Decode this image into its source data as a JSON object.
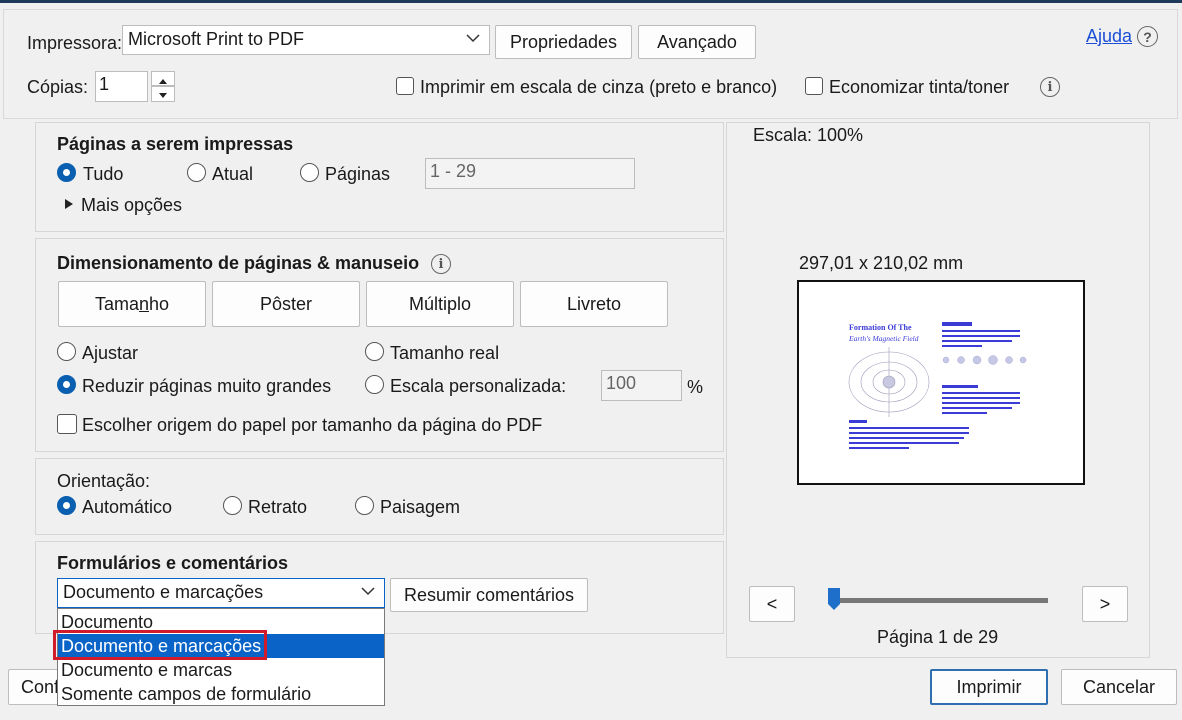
{
  "printer": {
    "label": "Impressora:",
    "selected": "Microsoft Print to PDF",
    "properties_button": "Propriedades",
    "advanced_button": "Avançado",
    "help_link": "Ajuda"
  },
  "copies": {
    "label": "Cópias:",
    "value": "1",
    "grayscale_label": "Imprimir em escala de cinza (preto e branco)",
    "save_ink_label": "Economizar tinta/toner"
  },
  "pages_to_print": {
    "title": "Páginas a serem impressas",
    "options": [
      "Tudo",
      "Atual",
      "Páginas"
    ],
    "selected": "Tudo",
    "range_value": "1 - 29",
    "more_options": "Mais opções"
  },
  "sizing": {
    "title": "Dimensionamento de páginas & manuseio",
    "tab_tamanho_pre": "Tama",
    "tab_tamanho_u": "n",
    "tab_tamanho_post": "ho",
    "tabs": [
      "Tamanho",
      "Pôster",
      "Múltiplo",
      "Livreto"
    ],
    "fit_label": "Ajustar",
    "actual_size_label": "Tamanho real",
    "shrink_label": "Reduzir páginas muito grandes",
    "custom_scale_label": "Escala personalizada:",
    "custom_scale_value": "100",
    "percent": "%",
    "paper_source_label": "Escolher origem do papel por tamanho da página do PDF"
  },
  "orientation": {
    "title": "Orientação:",
    "auto": "Automático",
    "portrait": "Retrato",
    "landscape": "Paisagem"
  },
  "forms": {
    "title": "Formulários e comentários",
    "selected": "Documento e marcações",
    "summarize_button": "Resumir comentários",
    "options": [
      "Documento",
      "Documento e marcações",
      "Documento e marcas",
      "Somente campos de formulário"
    ]
  },
  "preview": {
    "scale": "Escala: 100%",
    "dimensions": "297,01 x 210,02 mm",
    "prev": "<",
    "next": ">",
    "page_label": "Página 1 de 29",
    "page_fraction": 0.0,
    "thumb_title_1": "Formation Of The",
    "thumb_title_2": "Earth's Magnetic Field"
  },
  "footer": {
    "config_button_partial": "Conf",
    "print_button": "Imprimir",
    "cancel_button": "Cancelar"
  },
  "colors": {
    "accent": "#0a5fb0",
    "selection": "#0a64c8",
    "highlight": "#d11a2a",
    "thumb_text": "#3b3bd6"
  }
}
